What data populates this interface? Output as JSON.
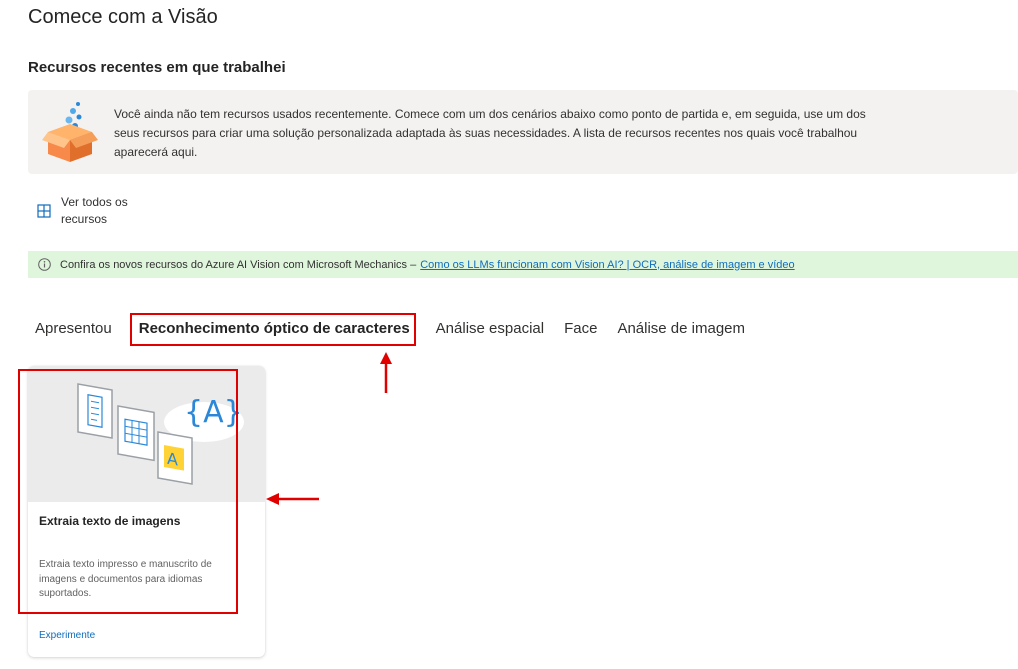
{
  "page": {
    "title": "Comece com a Visão"
  },
  "recent": {
    "section_title": "Recursos recentes em que trabalhei",
    "empty_message": "Você ainda não tem recursos usados recentemente. Comece com um dos cenários abaixo como ponto de partida e, em seguida, use um dos seus recursos para criar uma solução personalizada adaptada às suas necessidades. A lista de recursos recentes nos quais você trabalhou aparecerá aqui.",
    "illustration_icon": "box-with-bubbles-icon",
    "see_all_label": "Ver todos os recursos",
    "see_all_icon": "grid-icon"
  },
  "info_bar": {
    "icon": "info-icon",
    "text": "Confira os novos recursos do Azure AI Vision com Microsoft Mechanics –",
    "link_text": "Como os LLMs funcionam com Vision AI? | OCR, análise de imagem e vídeo",
    "background_color": "#dff6dd"
  },
  "tabs": [
    {
      "label": "Apresentou",
      "active": false
    },
    {
      "label": "Reconhecimento óptico de caracteres",
      "active": true
    },
    {
      "label": "Análise espacial",
      "active": false
    },
    {
      "label": "Face",
      "active": false
    },
    {
      "label": "Análise de imagem",
      "active": false
    }
  ],
  "cards": [
    {
      "image_icon": "ocr-documents-illustration",
      "title": "Extraia texto de imagens",
      "description": "Extraia texto impresso e manuscrito de imagens e documentos para idiomas suportados.",
      "action_label": "Experimente"
    }
  ],
  "colors": {
    "annotation_red": "#e00000",
    "link_blue": "#0f6cbd"
  }
}
